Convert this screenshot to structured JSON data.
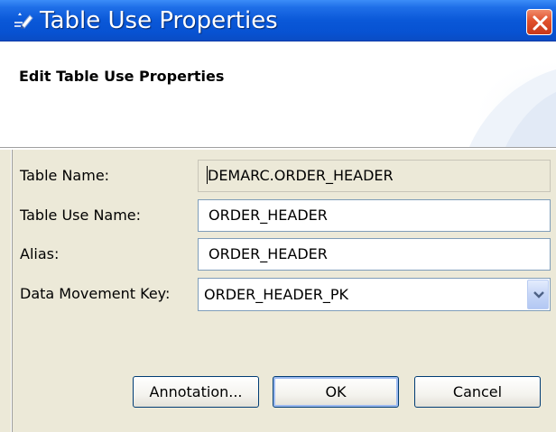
{
  "window": {
    "title": "Table Use Properties",
    "app_icon": "pencil-app-icon",
    "close_icon": "close-icon"
  },
  "header": {
    "title": "Edit Table Use Properties"
  },
  "form": {
    "table_name": {
      "label": "Table Name:",
      "value": "DEMARC.ORDER_HEADER",
      "readonly": true
    },
    "table_use_name": {
      "label": "Table Use Name:",
      "value": "ORDER_HEADER"
    },
    "alias": {
      "label": "Alias:",
      "value": "ORDER_HEADER"
    },
    "data_movement_key": {
      "label": "Data Movement Key:",
      "value": "ORDER_HEADER_PK",
      "dropdown_icon": "chevron-down-icon"
    }
  },
  "buttons": {
    "annotation": "Annotation...",
    "ok": "OK",
    "cancel": "Cancel"
  },
  "colors": {
    "titlebar": "#0a58d8",
    "dialog_bg": "#ece9d8",
    "close_button": "#e0512d",
    "input_border": "#7f9db9"
  }
}
